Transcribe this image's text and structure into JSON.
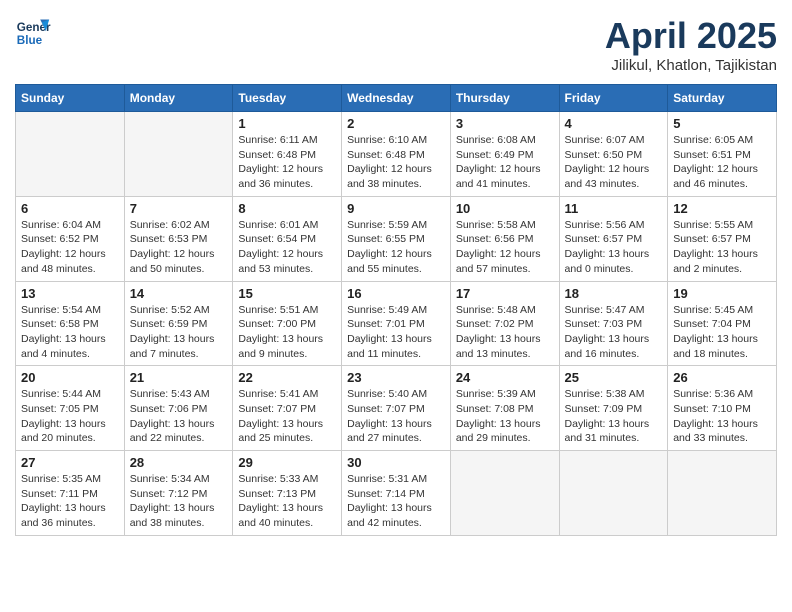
{
  "header": {
    "logo_line1": "General",
    "logo_line2": "Blue",
    "month_title": "April 2025",
    "location": "Jilikul, Khatlon, Tajikistan"
  },
  "days_of_week": [
    "Sunday",
    "Monday",
    "Tuesday",
    "Wednesday",
    "Thursday",
    "Friday",
    "Saturday"
  ],
  "weeks": [
    [
      {
        "day": "",
        "info": ""
      },
      {
        "day": "",
        "info": ""
      },
      {
        "day": "1",
        "info": "Sunrise: 6:11 AM\nSunset: 6:48 PM\nDaylight: 12 hours\nand 36 minutes."
      },
      {
        "day": "2",
        "info": "Sunrise: 6:10 AM\nSunset: 6:48 PM\nDaylight: 12 hours\nand 38 minutes."
      },
      {
        "day": "3",
        "info": "Sunrise: 6:08 AM\nSunset: 6:49 PM\nDaylight: 12 hours\nand 41 minutes."
      },
      {
        "day": "4",
        "info": "Sunrise: 6:07 AM\nSunset: 6:50 PM\nDaylight: 12 hours\nand 43 minutes."
      },
      {
        "day": "5",
        "info": "Sunrise: 6:05 AM\nSunset: 6:51 PM\nDaylight: 12 hours\nand 46 minutes."
      }
    ],
    [
      {
        "day": "6",
        "info": "Sunrise: 6:04 AM\nSunset: 6:52 PM\nDaylight: 12 hours\nand 48 minutes."
      },
      {
        "day": "7",
        "info": "Sunrise: 6:02 AM\nSunset: 6:53 PM\nDaylight: 12 hours\nand 50 minutes."
      },
      {
        "day": "8",
        "info": "Sunrise: 6:01 AM\nSunset: 6:54 PM\nDaylight: 12 hours\nand 53 minutes."
      },
      {
        "day": "9",
        "info": "Sunrise: 5:59 AM\nSunset: 6:55 PM\nDaylight: 12 hours\nand 55 minutes."
      },
      {
        "day": "10",
        "info": "Sunrise: 5:58 AM\nSunset: 6:56 PM\nDaylight: 12 hours\nand 57 minutes."
      },
      {
        "day": "11",
        "info": "Sunrise: 5:56 AM\nSunset: 6:57 PM\nDaylight: 13 hours\nand 0 minutes."
      },
      {
        "day": "12",
        "info": "Sunrise: 5:55 AM\nSunset: 6:57 PM\nDaylight: 13 hours\nand 2 minutes."
      }
    ],
    [
      {
        "day": "13",
        "info": "Sunrise: 5:54 AM\nSunset: 6:58 PM\nDaylight: 13 hours\nand 4 minutes."
      },
      {
        "day": "14",
        "info": "Sunrise: 5:52 AM\nSunset: 6:59 PM\nDaylight: 13 hours\nand 7 minutes."
      },
      {
        "day": "15",
        "info": "Sunrise: 5:51 AM\nSunset: 7:00 PM\nDaylight: 13 hours\nand 9 minutes."
      },
      {
        "day": "16",
        "info": "Sunrise: 5:49 AM\nSunset: 7:01 PM\nDaylight: 13 hours\nand 11 minutes."
      },
      {
        "day": "17",
        "info": "Sunrise: 5:48 AM\nSunset: 7:02 PM\nDaylight: 13 hours\nand 13 minutes."
      },
      {
        "day": "18",
        "info": "Sunrise: 5:47 AM\nSunset: 7:03 PM\nDaylight: 13 hours\nand 16 minutes."
      },
      {
        "day": "19",
        "info": "Sunrise: 5:45 AM\nSunset: 7:04 PM\nDaylight: 13 hours\nand 18 minutes."
      }
    ],
    [
      {
        "day": "20",
        "info": "Sunrise: 5:44 AM\nSunset: 7:05 PM\nDaylight: 13 hours\nand 20 minutes."
      },
      {
        "day": "21",
        "info": "Sunrise: 5:43 AM\nSunset: 7:06 PM\nDaylight: 13 hours\nand 22 minutes."
      },
      {
        "day": "22",
        "info": "Sunrise: 5:41 AM\nSunset: 7:07 PM\nDaylight: 13 hours\nand 25 minutes."
      },
      {
        "day": "23",
        "info": "Sunrise: 5:40 AM\nSunset: 7:07 PM\nDaylight: 13 hours\nand 27 minutes."
      },
      {
        "day": "24",
        "info": "Sunrise: 5:39 AM\nSunset: 7:08 PM\nDaylight: 13 hours\nand 29 minutes."
      },
      {
        "day": "25",
        "info": "Sunrise: 5:38 AM\nSunset: 7:09 PM\nDaylight: 13 hours\nand 31 minutes."
      },
      {
        "day": "26",
        "info": "Sunrise: 5:36 AM\nSunset: 7:10 PM\nDaylight: 13 hours\nand 33 minutes."
      }
    ],
    [
      {
        "day": "27",
        "info": "Sunrise: 5:35 AM\nSunset: 7:11 PM\nDaylight: 13 hours\nand 36 minutes."
      },
      {
        "day": "28",
        "info": "Sunrise: 5:34 AM\nSunset: 7:12 PM\nDaylight: 13 hours\nand 38 minutes."
      },
      {
        "day": "29",
        "info": "Sunrise: 5:33 AM\nSunset: 7:13 PM\nDaylight: 13 hours\nand 40 minutes."
      },
      {
        "day": "30",
        "info": "Sunrise: 5:31 AM\nSunset: 7:14 PM\nDaylight: 13 hours\nand 42 minutes."
      },
      {
        "day": "",
        "info": ""
      },
      {
        "day": "",
        "info": ""
      },
      {
        "day": "",
        "info": ""
      }
    ]
  ]
}
